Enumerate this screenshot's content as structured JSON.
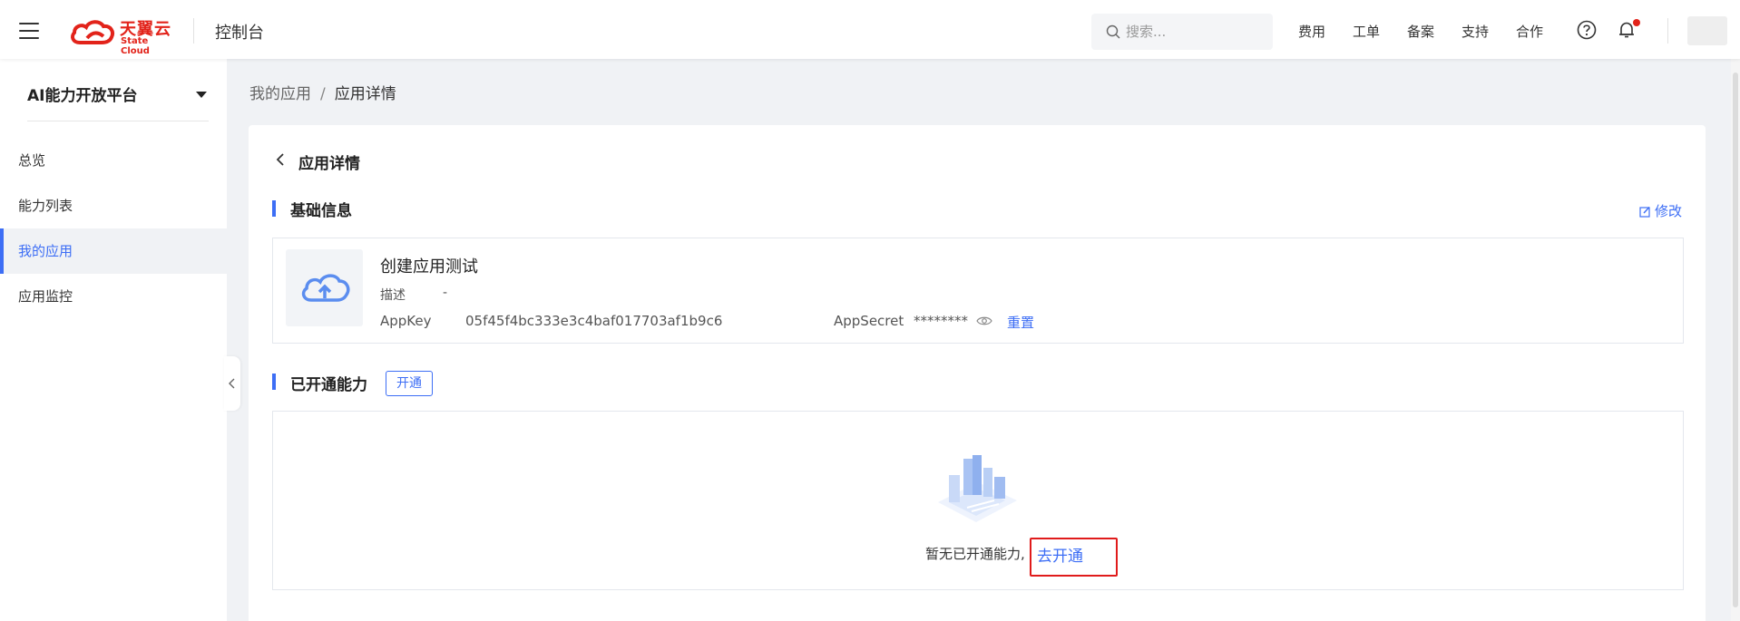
{
  "header": {
    "logo_cn": "天翼云",
    "logo_en": "State Cloud",
    "console_title": "控制台",
    "search_placeholder": "搜索...",
    "nav": [
      "费用",
      "工单",
      "备案",
      "支持",
      "合作"
    ]
  },
  "sidebar": {
    "platform": "AI能力开放平台",
    "items": [
      {
        "label": "总览",
        "active": false
      },
      {
        "label": "能力列表",
        "active": false
      },
      {
        "label": "我的应用",
        "active": true
      },
      {
        "label": "应用监控",
        "active": false
      }
    ]
  },
  "breadcrumb": {
    "parent": "我的应用",
    "separator": "/",
    "current": "应用详情"
  },
  "detail": {
    "back_title": "应用详情",
    "basic_section": "基础信息",
    "edit_label": "修改",
    "app_name": "创建应用测试",
    "desc_label": "描述",
    "desc_value": "-",
    "appkey_label": "AppKey",
    "appkey_value": "05f45f4bc333e3c4baf017703af1b9c6",
    "appsecret_label": "AppSecret",
    "appsecret_value": "********",
    "reset_label": "重置",
    "opened_section": "已开通能力",
    "open_button": "开通",
    "empty_text": "暂无已开通能力,",
    "go_open_label": "去开通"
  },
  "colors": {
    "accent": "#3d6ef5",
    "brand": "#e2231a",
    "highlight_box": "#e01b1b"
  }
}
